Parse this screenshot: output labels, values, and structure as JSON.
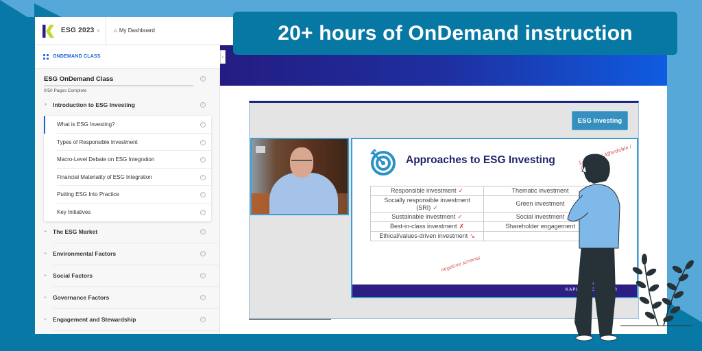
{
  "headline": "20+ hours of OnDemand instruction",
  "topbar": {
    "course": "ESG 2023",
    "dashboard_link": "My Dashboard"
  },
  "sidebar": {
    "section_label": "ONDEMAND CLASS",
    "class_title": "ESG OnDemand Class",
    "pages_complete": "0/50 Pages Complete",
    "progress_fraction": 0,
    "open_module": "Introduction to ESG Investing",
    "lessons": [
      {
        "label": "What is ESG Investing?",
        "active": true
      },
      {
        "label": "Types of Responsible Investment",
        "active": false
      },
      {
        "label": "Macro-Level Debate on ESG Integration",
        "active": false
      },
      {
        "label": "Financial Materiality of ESG Integration",
        "active": false
      },
      {
        "label": "Putting ESG Into Practice",
        "active": false
      },
      {
        "label": "Key Initiatives",
        "active": false
      }
    ],
    "modules": [
      {
        "label": "The ESG Market"
      },
      {
        "label": "Environmental Factors"
      },
      {
        "label": "Social Factors"
      },
      {
        "label": "Governance Factors"
      },
      {
        "label": "Engagement and Stewardship"
      }
    ]
  },
  "player": {
    "topic_chip": "ESG Investing",
    "slide": {
      "title": "Approaches to ESG Investing",
      "rows": [
        {
          "left": "Responsible investment",
          "left_mark": "✓",
          "right": "Thematic investment"
        },
        {
          "left": "Socially responsible investment (SRI)",
          "left_mark": "✓",
          "right": "Green investment"
        },
        {
          "left": "Sustainable investment",
          "left_mark": "✓",
          "right": "Social investment"
        },
        {
          "left": "Best-in-class investment",
          "left_mark": "✗",
          "right": "Shareholder engagement"
        },
        {
          "left": "Ethical/values-driven investment",
          "left_mark": "↘",
          "right": ""
        }
      ],
      "annotations": {
        "top_right": "Legacies / Affordable / Change",
        "bottom": "negative screens"
      },
      "footer_brand": "KAPLAN SCHWESER"
    }
  },
  "colors": {
    "accent": "#1f63d6",
    "banner_start": "#241c82",
    "banner_end": "#0f5ce0",
    "callout": "#0778a3",
    "chip": "#3590c0",
    "slide_title": "#21256b",
    "annotation": "#d23b3b"
  }
}
